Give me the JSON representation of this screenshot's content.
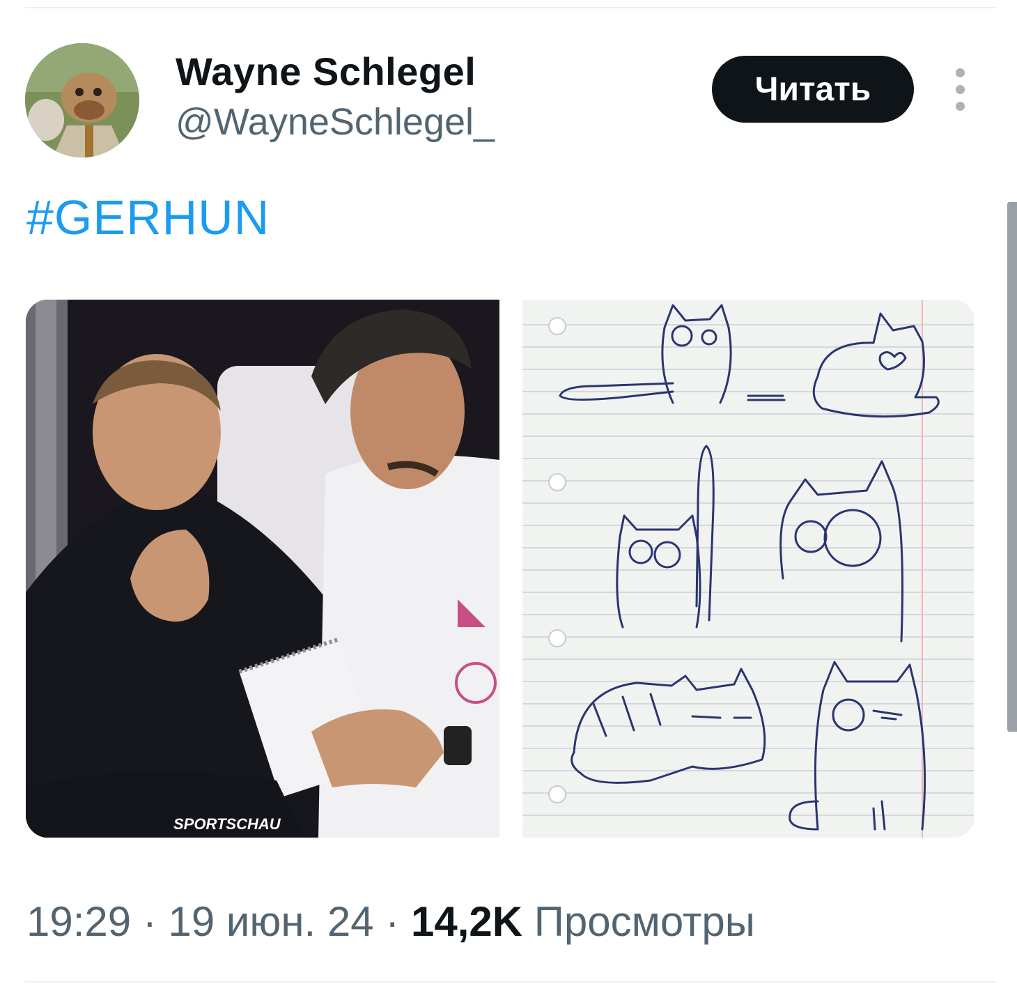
{
  "author": {
    "name": "Wayne Schlegel",
    "handle": "@WayneSchlegel_",
    "avatar_icon": "avatar-photo"
  },
  "actions": {
    "follow_label": "Читать",
    "more_icon": "more-vertical-icon"
  },
  "tweet": {
    "hashtag": "#GERHUN"
  },
  "media": {
    "left_watermark": "SPORTSCHAU",
    "right_description_icon": "cat-doodles-image"
  },
  "meta": {
    "time": "19:29",
    "separator": "·",
    "date": "19 июн. 24",
    "views_count": "14,2K",
    "views_label": "Просмотры"
  },
  "colors": {
    "link": "#1d9bf0",
    "text": "#0f1419",
    "secondary": "#536471",
    "button_bg": "#0f1419"
  }
}
